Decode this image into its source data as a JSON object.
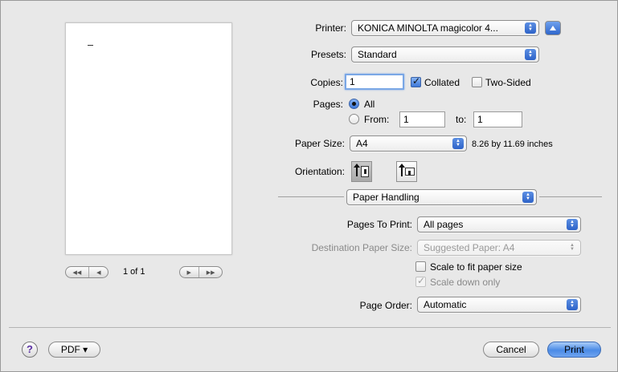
{
  "preview": {
    "page_count": "1 of 1"
  },
  "printer": {
    "label": "Printer:",
    "value": "KONICA MINOLTA magicolor 4..."
  },
  "presets": {
    "label": "Presets:",
    "value": "Standard"
  },
  "copies": {
    "label": "Copies:",
    "value": "1",
    "collated_label": "Collated",
    "collated_checked": true,
    "two_sided_label": "Two-Sided",
    "two_sided_checked": false
  },
  "pages": {
    "label": "Pages:",
    "all_label": "All",
    "from_label": "From:",
    "from_value": "1",
    "to_label": "to:",
    "to_value": "1",
    "selected": "All"
  },
  "paper_size": {
    "label": "Paper Size:",
    "value": "A4",
    "dimensions": "8.26 by 11.69 inches"
  },
  "orientation": {
    "label": "Orientation:",
    "selected": "portrait"
  },
  "section": {
    "value": "Paper Handling"
  },
  "paper_handling": {
    "pages_to_print_label": "Pages To Print:",
    "pages_to_print_value": "All pages",
    "destination_label": "Destination Paper Size:",
    "destination_value": "Suggested Paper: A4",
    "scale_fit_label": "Scale to fit paper size",
    "scale_fit_checked": false,
    "scale_down_label": "Scale down only",
    "scale_down_checked": true,
    "page_order_label": "Page Order:",
    "page_order_value": "Automatic"
  },
  "footer": {
    "help_label": "?",
    "pdf_label": "PDF ▾",
    "cancel_label": "Cancel",
    "print_label": "Print"
  },
  "colors": {
    "accent": "#3e78d8",
    "default_button": "#4a8ae6"
  }
}
